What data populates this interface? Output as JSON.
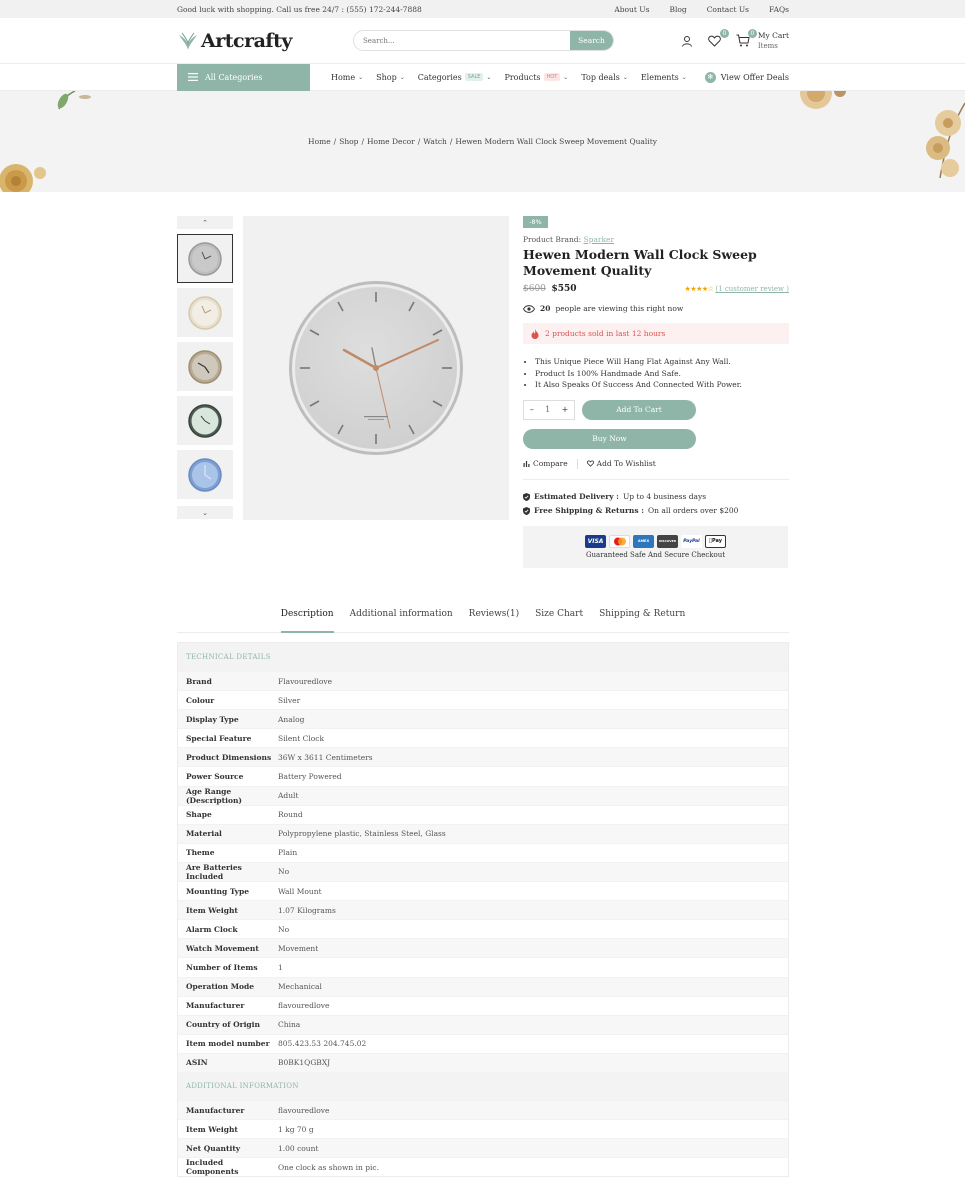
{
  "topbar": {
    "message": "Good luck with shopping. Call us free 24/7 : (555) 172-244-7888",
    "links": [
      "About Us",
      "Blog",
      "Contact Us",
      "FAQs"
    ]
  },
  "header": {
    "logo": "Artcrafty",
    "search_placeholder": "Search...",
    "search_button": "Search",
    "wishlist_count": "0",
    "cart_count": "0",
    "cart_title": "My Cart",
    "cart_sub": "Items"
  },
  "nav": {
    "all_categories": "All Categories",
    "items": [
      {
        "label": "Home",
        "tag": ""
      },
      {
        "label": "Shop",
        "tag": ""
      },
      {
        "label": "Categories",
        "tag": "SALE"
      },
      {
        "label": "Products",
        "tag": "HOT"
      },
      {
        "label": "Top deals",
        "tag": ""
      },
      {
        "label": "Elements",
        "tag": ""
      }
    ],
    "offer": "View Offer Deals"
  },
  "breadcrumb": [
    "Home",
    "/",
    "Shop",
    "/",
    "Home Decor",
    "/",
    "Watch",
    "/",
    "Hewen Modern Wall Clock Sweep Movement Quality"
  ],
  "product": {
    "discount": "-8%",
    "brand_label": "Product Brand:",
    "brand": "Sparker",
    "title": "Hewen Modern Wall Clock Sweep Movement Quality",
    "price_old": "$600",
    "price_new": "$550",
    "rating": 4,
    "stars": "★★★★☆",
    "review_link": "(1 customer review )",
    "viewing_count": "20",
    "viewing_text": "people are viewing this right now",
    "sold_text": "2 products sold in last 12 hours",
    "bullets": [
      "This Unique Piece Will Hang Flat Against Any Wall.",
      "Product Is 100% Handmade And Safe.",
      "It Also Speaks Of Success And Connected With Power."
    ],
    "qty_minus": "–",
    "qty": "1",
    "qty_plus": "+",
    "add_to_cart": "Add To Cart",
    "buy_now": "Buy Now",
    "compare": "Compare",
    "wishlist": "Add To Wishlist",
    "delivery_label": "Estimated Delivery :",
    "delivery_value": "Up to 4 business days",
    "shipping_label": "Free Shipping & Returns :",
    "shipping_value": "On all orders over $200",
    "secure_text": "Guaranteed Safe And Secure Checkout",
    "cards": [
      "VISA",
      "MC",
      "AMEX",
      "DISCOVER",
      "PayPal",
      "Pay"
    ],
    "thumb_colors": [
      "#c9c9c9",
      "#f2eee6",
      "#cfc8bd",
      "#d9e6dc",
      "#aac4e8"
    ]
  },
  "tabs": [
    "Description",
    "Additional information",
    "Reviews(1)",
    "Size Chart",
    "Shipping & Return"
  ],
  "technical": {
    "heading": "TECHNICAL DETAILS",
    "rows": [
      [
        "Brand",
        "Flavouredlove"
      ],
      [
        "Colour",
        "Silver"
      ],
      [
        "Display Type",
        "Analog"
      ],
      [
        "Special Feature",
        "Silent Clock"
      ],
      [
        "Product Dimensions",
        "36W x 3611 Centimeters"
      ],
      [
        "Power Source",
        "Battery Powered"
      ],
      [
        "Age Range (Description)",
        "Adult"
      ],
      [
        "Shape",
        "Round"
      ],
      [
        "Material",
        "Polypropylene plastic, Stainless Steel, Glass"
      ],
      [
        "Theme",
        "Plain"
      ],
      [
        "Are Batteries Included",
        "No"
      ],
      [
        "Mounting Type",
        "Wall Mount"
      ],
      [
        "Item Weight",
        "1.07 Kilograms"
      ],
      [
        "Alarm Clock",
        "No"
      ],
      [
        "Watch Movement",
        "Movement"
      ],
      [
        "Number of Items",
        "1"
      ],
      [
        "Operation Mode",
        "Mechanical"
      ],
      [
        "Manufacturer",
        "flavouredlove"
      ],
      [
        "Country of Origin",
        "China"
      ],
      [
        "Item model number",
        "805.423.53 204.745.02"
      ],
      [
        "ASIN",
        "B0BK1QGBXJ"
      ]
    ]
  },
  "additional": {
    "heading": "ADDITIONAL INFORMATION",
    "rows": [
      [
        "Manufacturer",
        "flavouredlove"
      ],
      [
        "Item Weight",
        "1 kg 70 g"
      ],
      [
        "Net Quantity",
        "1.00 count"
      ],
      [
        "Included Components",
        "One clock as shown in pic."
      ]
    ]
  }
}
